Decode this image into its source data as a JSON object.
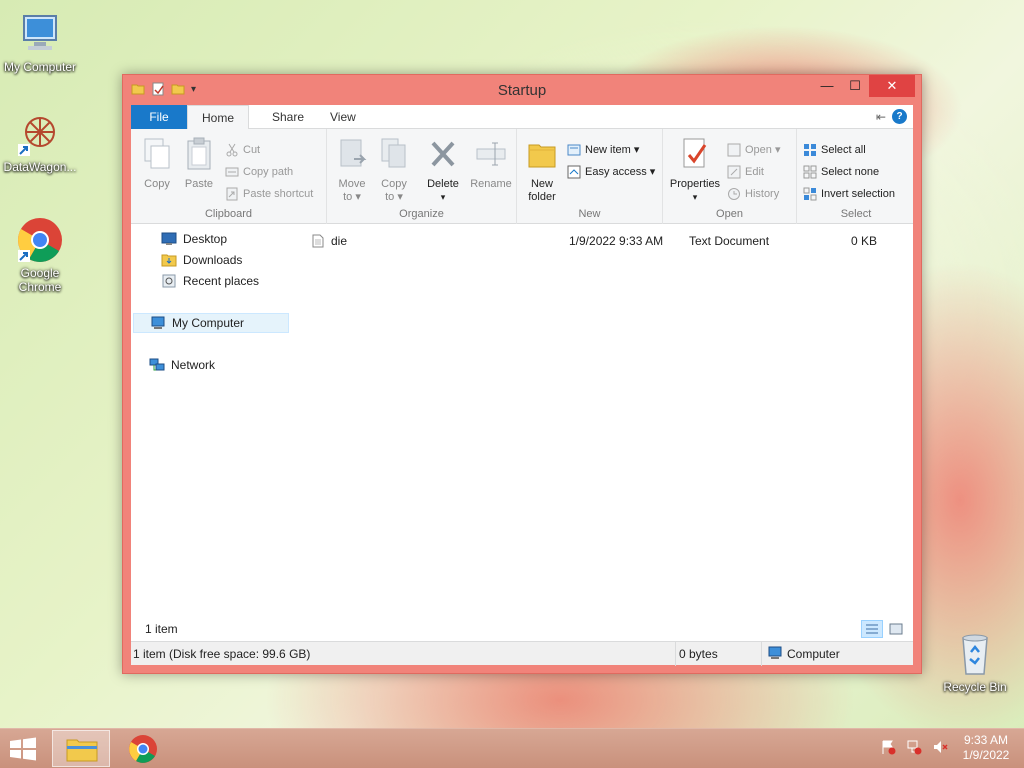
{
  "desktop": {
    "icons": [
      {
        "label": "My Computer"
      },
      {
        "label": "DataWagon..."
      },
      {
        "label": "Google Chrome"
      },
      {
        "label": "Recycle Bin"
      }
    ]
  },
  "window": {
    "title": "Startup",
    "tabs": [
      "File",
      "Home",
      "Share",
      "View"
    ],
    "help_label": "?",
    "controls": {
      "minimize": "—",
      "maximize": "☐",
      "close": "✕"
    }
  },
  "ribbon": {
    "clipboard": {
      "label": "Clipboard",
      "copy": "Copy",
      "paste": "Paste",
      "cut": "Cut",
      "copy_path": "Copy path",
      "paste_shortcut": "Paste shortcut"
    },
    "organize": {
      "label": "Organize",
      "move_to_1": "Move",
      "move_to_2": "to ▾",
      "copy_to_1": "Copy",
      "copy_to_2": "to ▾",
      "delete": "Delete",
      "delete_arrow": "▾",
      "rename": "Rename"
    },
    "new": {
      "label": "New",
      "new_folder_1": "New",
      "new_folder_2": "folder",
      "new_item": "New item ▾",
      "easy_access": "Easy access ▾"
    },
    "open": {
      "label": "Open",
      "properties": "Properties",
      "properties_arrow": "▾",
      "open": "Open ▾",
      "edit": "Edit",
      "history": "History"
    },
    "select": {
      "label": "Select",
      "select_all": "Select all",
      "select_none": "Select none",
      "invert_selection": "Invert selection"
    }
  },
  "nav": {
    "items": [
      {
        "label": "Desktop"
      },
      {
        "label": "Downloads"
      },
      {
        "label": "Recent places"
      },
      {
        "label": "My Computer"
      },
      {
        "label": "Network"
      }
    ]
  },
  "files": [
    {
      "name": "die",
      "date": "1/9/2022 9:33 AM",
      "type": "Text Document",
      "size": "0 KB"
    }
  ],
  "status": {
    "count": "1 item",
    "disk": "1 item (Disk free space: 99.6 GB)",
    "bytes": "0 bytes",
    "location": "Computer"
  },
  "taskbar": {
    "time": "9:33 AM",
    "date": "1/9/2022"
  },
  "colors": {
    "accent": "#1979ca",
    "window_frame": "#f1837a",
    "close": "#e04343"
  }
}
